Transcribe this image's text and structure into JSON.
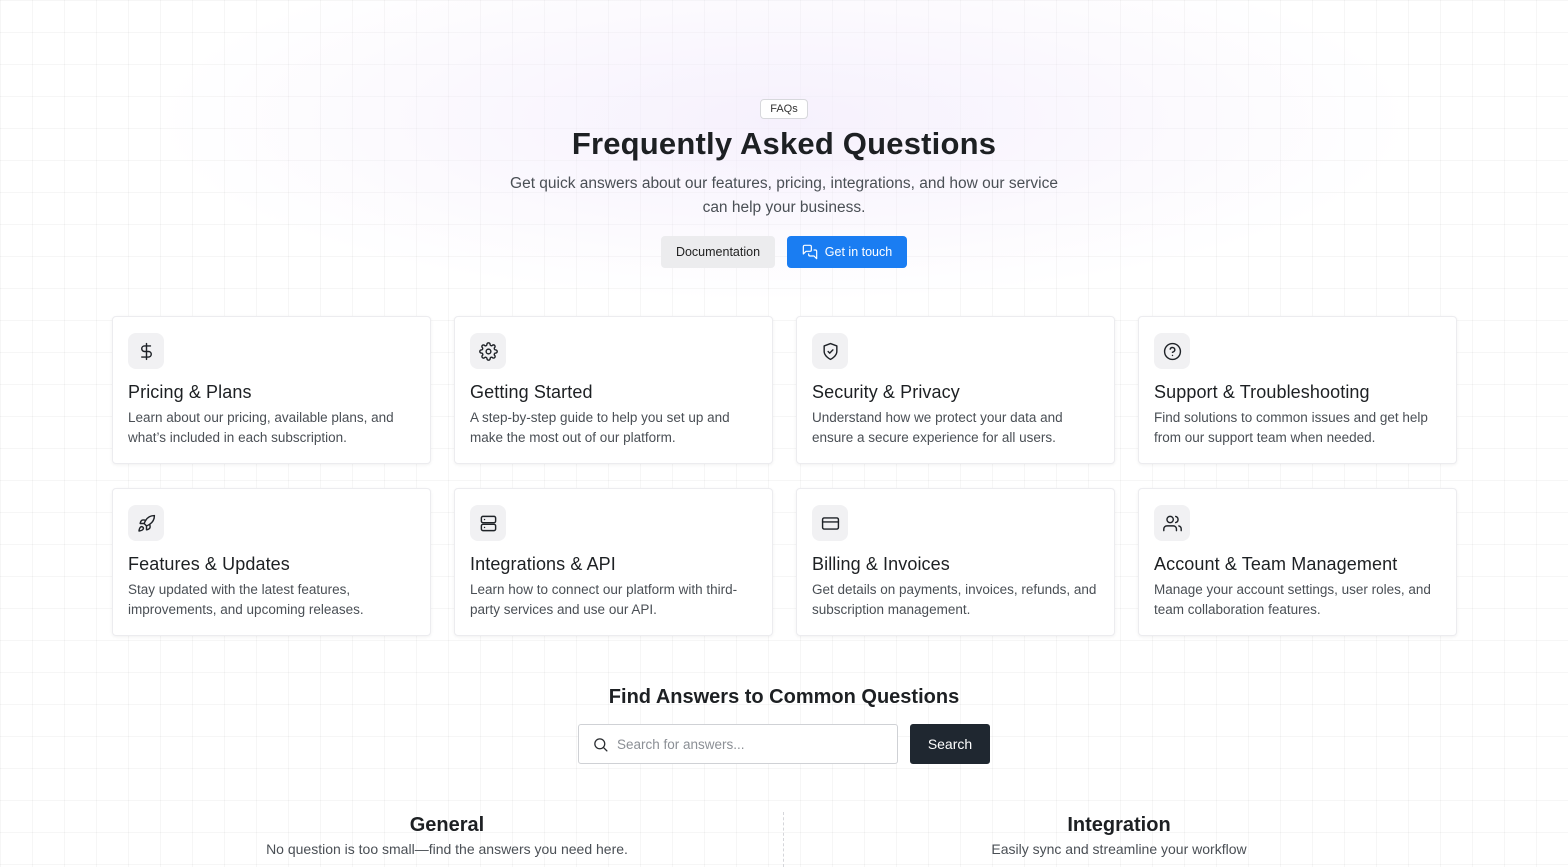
{
  "hero": {
    "badge": "FAQs",
    "title": "Frequently Asked Questions",
    "subtitle": "Get quick answers about our features, pricing, integrations, and how our service can help your business.",
    "documentation_label": "Documentation",
    "get_in_touch_label": "Get in touch",
    "accent_color": "#1a7df2"
  },
  "categories": [
    {
      "icon": "dollar-icon",
      "title": "Pricing & Plans",
      "description": "Learn about our pricing, available plans, and what’s included in each subscription."
    },
    {
      "icon": "gear-icon",
      "title": "Getting Started",
      "description": "A step-by-step guide to help you set up and make the most out of our platform."
    },
    {
      "icon": "shield-check-icon",
      "title": "Security & Privacy",
      "description": "Understand how we protect your data and ensure a secure experience for all users."
    },
    {
      "icon": "help-circle-icon",
      "title": "Support & Troubleshooting",
      "description": "Find solutions to common issues and get help from our support team when needed."
    },
    {
      "icon": "rocket-icon",
      "title": "Features & Updates",
      "description": "Stay updated with the latest features, improvements, and upcoming releases."
    },
    {
      "icon": "server-icon",
      "title": "Integrations & API",
      "description": "Learn how to connect our platform with third-party services and use our API."
    },
    {
      "icon": "credit-card-icon",
      "title": "Billing & Invoices",
      "description": "Get details on payments, invoices, refunds, and subscription management."
    },
    {
      "icon": "users-icon",
      "title": "Account & Team Management",
      "description": "Manage your account settings, user roles, and team collaboration features."
    }
  ],
  "search": {
    "heading": "Find Answers to Common Questions",
    "placeholder": "Search for answers...",
    "button_label": "Search"
  },
  "sections": [
    {
      "title": "General",
      "subtitle": "No question is too small—find the answers you need here."
    },
    {
      "title": "Integration",
      "subtitle": "Easily sync and streamline your workflow"
    }
  ]
}
